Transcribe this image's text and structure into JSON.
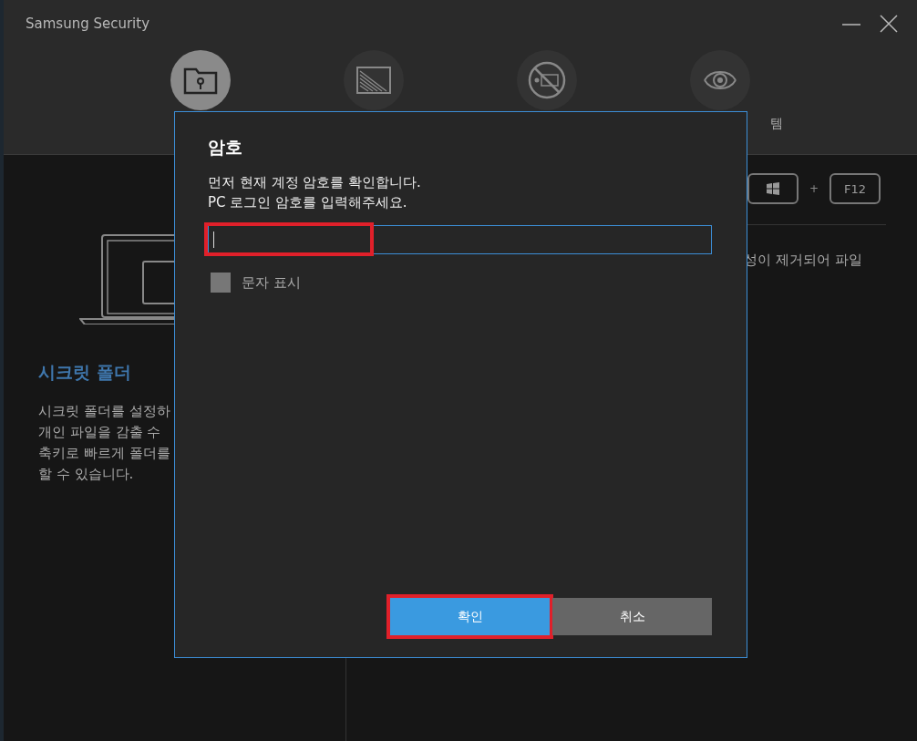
{
  "window": {
    "title": "Samsung Security"
  },
  "tabs": [
    {
      "selected": true,
      "kind": "folder"
    },
    {
      "selected": false,
      "kind": "screen"
    },
    {
      "selected": false,
      "kind": "rec"
    },
    {
      "label": "템",
      "selected": false,
      "kind": "eye"
    }
  ],
  "left_panel": {
    "heading": "시크릿 폴더",
    "description_lines": [
      "시크릿 폴더를 설정하",
      "개인 파일을 감출 수",
      "축키로 빠르게 폴더를",
      "할 수 있습니다."
    ]
  },
  "right_panel": {
    "shortcut_keys": [
      {
        "kind": "windows"
      },
      {
        "kind": "text",
        "label": "F12"
      }
    ],
    "separator": "+",
    "text": "성이 제거되어 파일"
  },
  "dialog": {
    "title": "암호",
    "message_lines": [
      "먼저 현재 계정 암호를 확인합니다.",
      "PC 로그인 암호를 입력해주세요."
    ],
    "password_field": {
      "focused": true,
      "highlighted": true
    },
    "show_characters": {
      "label": "문자 표시",
      "checked": false
    },
    "buttons": [
      {
        "label": "확인",
        "primary": true,
        "highlighted": true
      },
      {
        "label": "취소",
        "primary": false,
        "highlighted": false
      }
    ]
  }
}
